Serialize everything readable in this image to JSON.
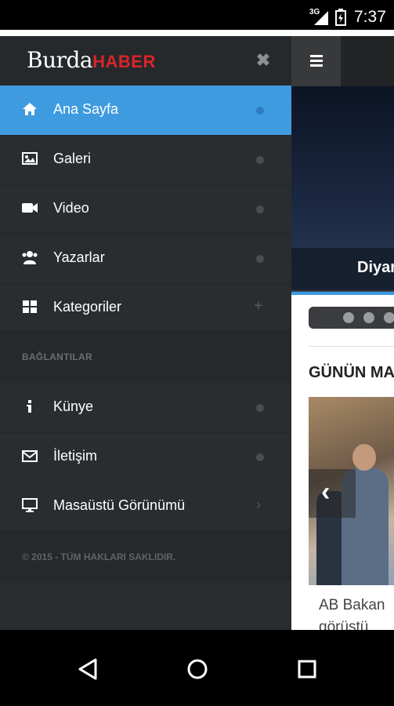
{
  "status_bar": {
    "network": "3G",
    "time": "7:37"
  },
  "app": {
    "logo_part1": "Burda",
    "logo_part2": "HABER",
    "close_glyph": "✖"
  },
  "drawer": {
    "items": [
      {
        "label": "Ana Sayfa",
        "icon": "home-icon",
        "active": true
      },
      {
        "label": "Galeri",
        "icon": "image-icon"
      },
      {
        "label": "Video",
        "icon": "video-camera-icon"
      },
      {
        "label": "Yazarlar",
        "icon": "users-icon"
      },
      {
        "label": "Kategoriler",
        "icon": "grid-icon",
        "trailing": "+"
      }
    ],
    "section_header": "BAĞLANTILAR",
    "links": [
      {
        "label": "Künye",
        "icon": "info-icon"
      },
      {
        "label": "İletişim",
        "icon": "envelope-icon"
      },
      {
        "label": "Masaüstü Görünümü",
        "icon": "desktop-icon",
        "trailing": "›"
      }
    ],
    "footer": "© 2015 - TÜM HAKLARI SAKLIDIR."
  },
  "main": {
    "hero_caption": "Diyar",
    "section_title": "GÜNÜN MA",
    "prev_arrow": "‹",
    "news_title_line1": "AB Bakan",
    "news_title_line2": "görüştü"
  },
  "colors": {
    "accent": "#3f9be0",
    "drawer_bg": "#2a2d30",
    "logo_red": "#d9252b"
  }
}
